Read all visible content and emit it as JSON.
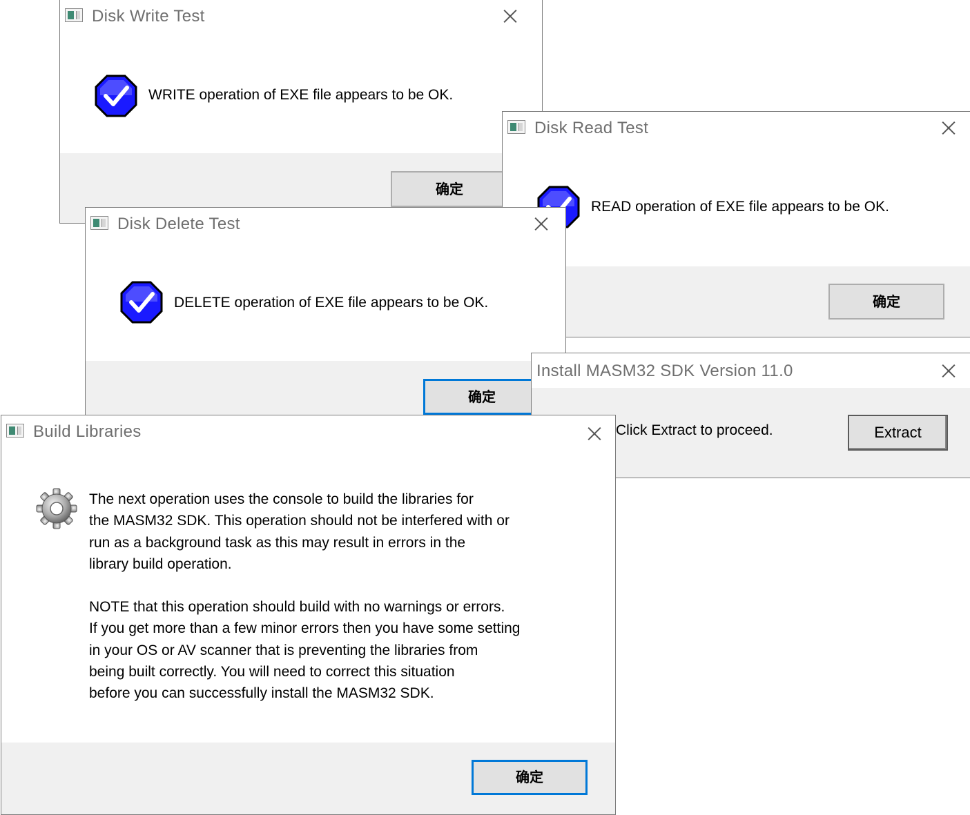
{
  "write_dialog": {
    "title": "Disk Write Test",
    "message": "WRITE operation of EXE file appears to be OK.",
    "ok_label": "确定",
    "icon": "checkmark-shield-icon"
  },
  "read_dialog": {
    "title": "Disk Read Test",
    "message": "READ operation of EXE file appears to be OK.",
    "ok_label": "确定",
    "icon": "checkmark-shield-icon"
  },
  "delete_dialog": {
    "title": "Disk Delete Test",
    "message": "DELETE operation of EXE file appears to be OK.",
    "ok_label": "确定",
    "icon": "checkmark-shield-icon"
  },
  "install_dialog": {
    "title": "Install MASM32 SDK Version 11.0",
    "message": "Click Extract to proceed.",
    "extract_label": "Extract"
  },
  "build_dialog": {
    "title": "Build Libraries",
    "icon": "gear-icon",
    "paragraph1": [
      "The next operation uses the console to build the libraries for",
      "the MASM32 SDK. This operation should not be interfered with or",
      "run as a background task as this may result in errors in the",
      "library build operation."
    ],
    "paragraph2": [
      "NOTE that this operation should build with no warnings or errors.",
      "If you get more than a few minor errors then you have some setting",
      "in your OS or AV scanner that is preventing the libraries from",
      "being built correctly. You will need to correct this situation",
      "before you can successfully install the MASM32 SDK."
    ],
    "ok_label": "确定"
  },
  "colors": {
    "shield_blue": "#1a1aff",
    "default_button_border": "#0078d7",
    "footer_gray": "#f0f0f0"
  }
}
